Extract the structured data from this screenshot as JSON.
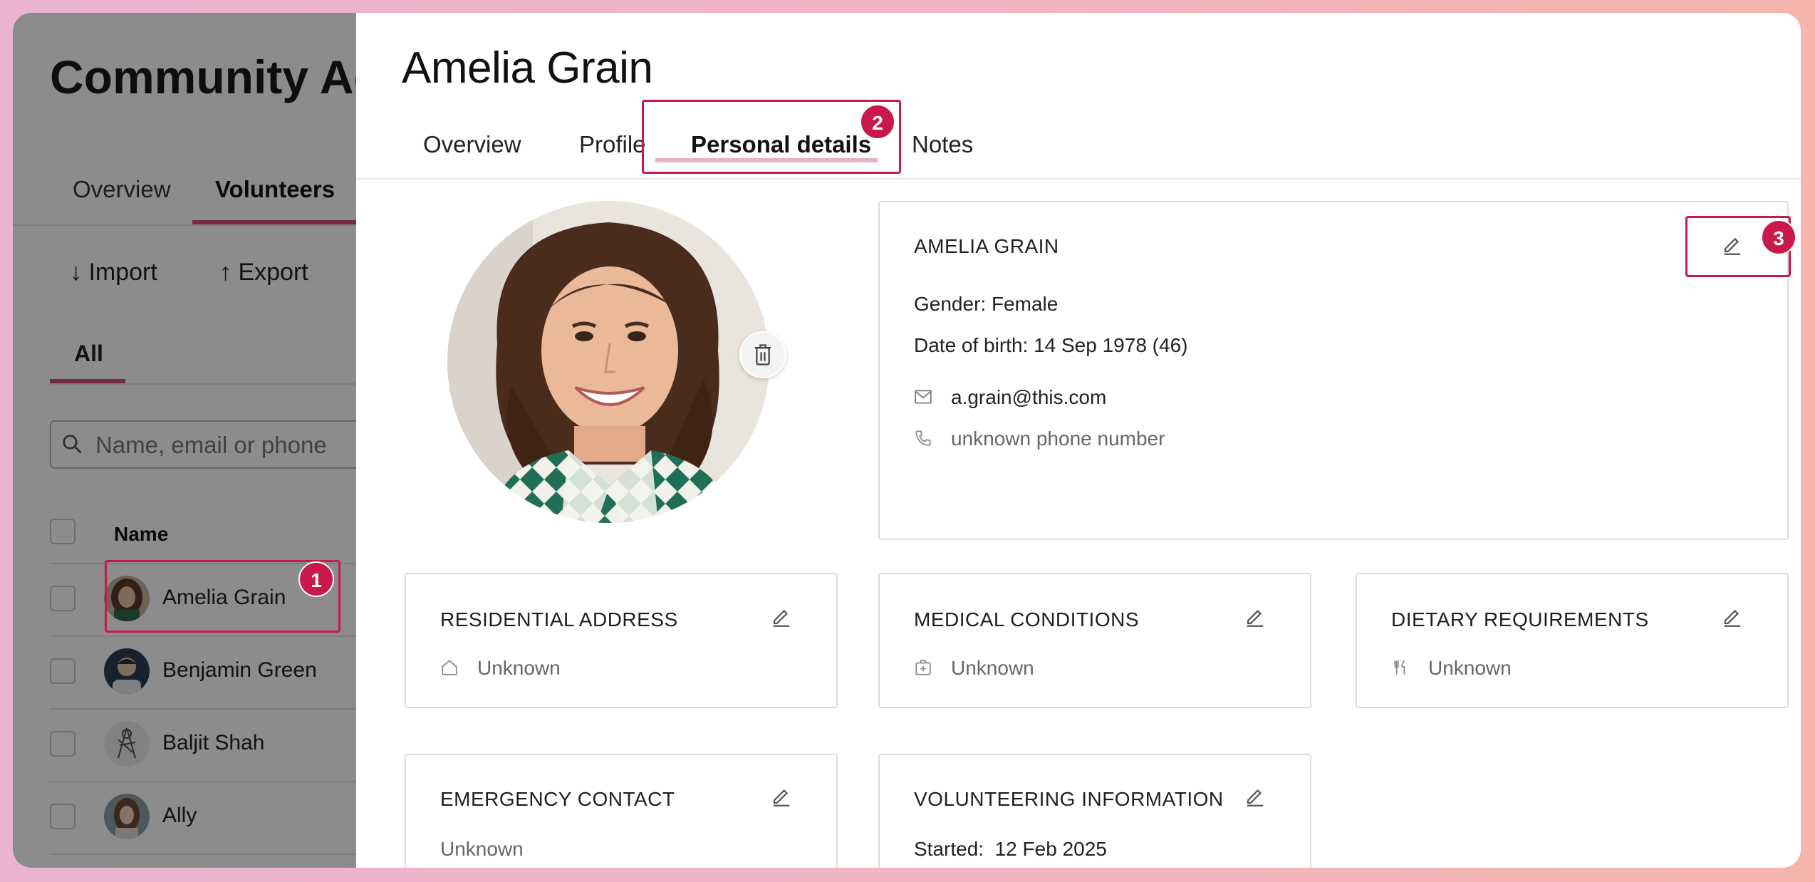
{
  "background_app": {
    "title": "Community Action Group",
    "tabs": [
      {
        "label": "Overview"
      },
      {
        "label": "Volunteers",
        "active": true
      }
    ],
    "actions": {
      "import_label": "Import",
      "export_label": "Export",
      "import_icon": "↓",
      "export_icon": "↑"
    },
    "filter_all": "All",
    "search_placeholder": "Name, email or phone",
    "table": {
      "name_header": "Name",
      "rows": [
        {
          "name": "Amelia Grain"
        },
        {
          "name": "Benjamin Green"
        },
        {
          "name": "Baljit Shah"
        },
        {
          "name": "Ally"
        }
      ]
    }
  },
  "drawer": {
    "title": "Amelia Grain",
    "tabs": [
      {
        "label": "Overview"
      },
      {
        "label": "Profile"
      },
      {
        "label": "Personal details",
        "active": true
      },
      {
        "label": "Notes"
      }
    ],
    "contact_card": {
      "name": "AMELIA GRAIN",
      "gender": "Gender: Female",
      "dob": "Date of birth: 14 Sep 1978 (46)",
      "email": "a.grain@this.com",
      "phone": "unknown phone number"
    },
    "cards": {
      "address": {
        "title": "RESIDENTIAL ADDRESS",
        "value": "Unknown",
        "icon": "home-icon"
      },
      "medical": {
        "title": "MEDICAL CONDITIONS",
        "value": "Unknown",
        "icon": "medical-kit-icon"
      },
      "dietary": {
        "title": "DIETARY REQUIREMENTS",
        "value": "Unknown",
        "icon": "cutlery-icon"
      },
      "emergency": {
        "title": "EMERGENCY CONTACT",
        "value": "Unknown"
      },
      "volunteering": {
        "title": "VOLUNTEERING INFORMATION",
        "started": "Started:  12 Feb 2025"
      }
    }
  },
  "annotations": {
    "badge1": "1",
    "badge2": "2",
    "badge3": "3"
  },
  "colors": {
    "accent": "#d94d7c",
    "highlight": "#c9184a",
    "tab_underline": "#eab0c5"
  }
}
